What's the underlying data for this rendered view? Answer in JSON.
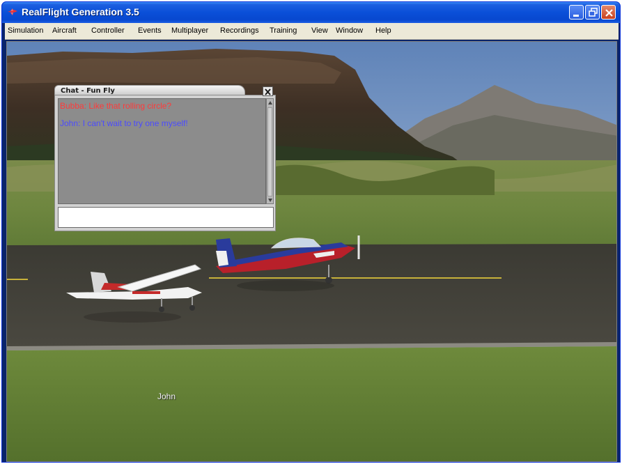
{
  "window": {
    "title": "RealFlight Generation 3.5"
  },
  "menu": {
    "items": [
      {
        "label": "Simulation"
      },
      {
        "label": "Aircraft"
      },
      {
        "label": "Controller"
      },
      {
        "label": "Events"
      },
      {
        "label": "Multiplayer"
      },
      {
        "label": "Recordings"
      },
      {
        "label": "Training"
      },
      {
        "label": "View"
      },
      {
        "label": "Window"
      },
      {
        "label": "Help"
      }
    ]
  },
  "chat": {
    "title": "Chat - Fun Fly",
    "messages": [
      {
        "text": "Bubba: Like that rolling circle?",
        "color": "#ff3a3a"
      },
      {
        "text": "John: I can't wait to try one myself!",
        "color": "#4b4bff"
      }
    ],
    "input_value": ""
  },
  "scene": {
    "player_label": "John",
    "aircraft": [
      "high-wing trainer",
      "aerobatic monoplane"
    ]
  },
  "icons": {
    "minimize": "minimize-icon",
    "maximize": "restore-icon",
    "close": "close-icon",
    "chat_close": "close-icon"
  },
  "colors": {
    "titlebar": "#0a4fd8",
    "menubar": "#ece9d8",
    "chat_bg": "#8c8c8c"
  }
}
